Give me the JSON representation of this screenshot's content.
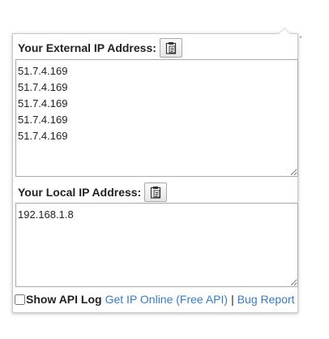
{
  "external": {
    "label": "Your External IP Address:",
    "copy_icon": "clipboard-icon",
    "value": "51.7.4.169\n51.7.4.169\n51.7.4.169\n51.7.4.169\n51.7.4.169"
  },
  "local": {
    "label": "Your Local IP Address:",
    "copy_icon": "clipboard-icon",
    "value": "192.168.1.8"
  },
  "footer": {
    "show_api_log_label": "Show API Log",
    "show_api_log_checked": false,
    "get_ip_link": "Get IP Online (Free API)",
    "separator": "|",
    "bug_report_link": "Bug Report"
  },
  "colors": {
    "link": "#3a7bbf",
    "border": "#a9a9a9"
  }
}
